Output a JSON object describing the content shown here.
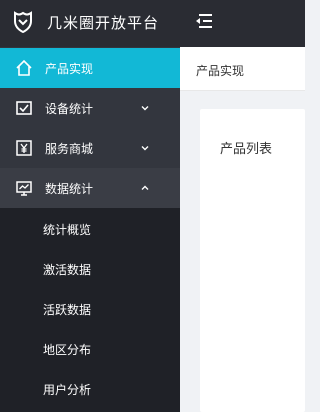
{
  "header": {
    "logo_icon": "tag-shield-icon",
    "title": "几米圈开放平台",
    "toggle_icon": "menu-fold-icon"
  },
  "sidebar": {
    "active_color": "#12b8d6",
    "items": [
      {
        "label": "产品实现",
        "icon": "home-icon",
        "active": true
      },
      {
        "label": "设备统计",
        "icon": "checkbox-icon",
        "expanded": false
      },
      {
        "label": "服务商城",
        "icon": "yen-icon",
        "expanded": false
      },
      {
        "label": "数据统计",
        "icon": "chart-icon",
        "expanded": true
      }
    ],
    "subitems": [
      {
        "label": "统计概览"
      },
      {
        "label": "激活数据"
      },
      {
        "label": "活跃数据"
      },
      {
        "label": "地区分布"
      },
      {
        "label": "用户分析"
      }
    ]
  },
  "main": {
    "breadcrumb": "产品实现",
    "card_title": "产品列表"
  }
}
